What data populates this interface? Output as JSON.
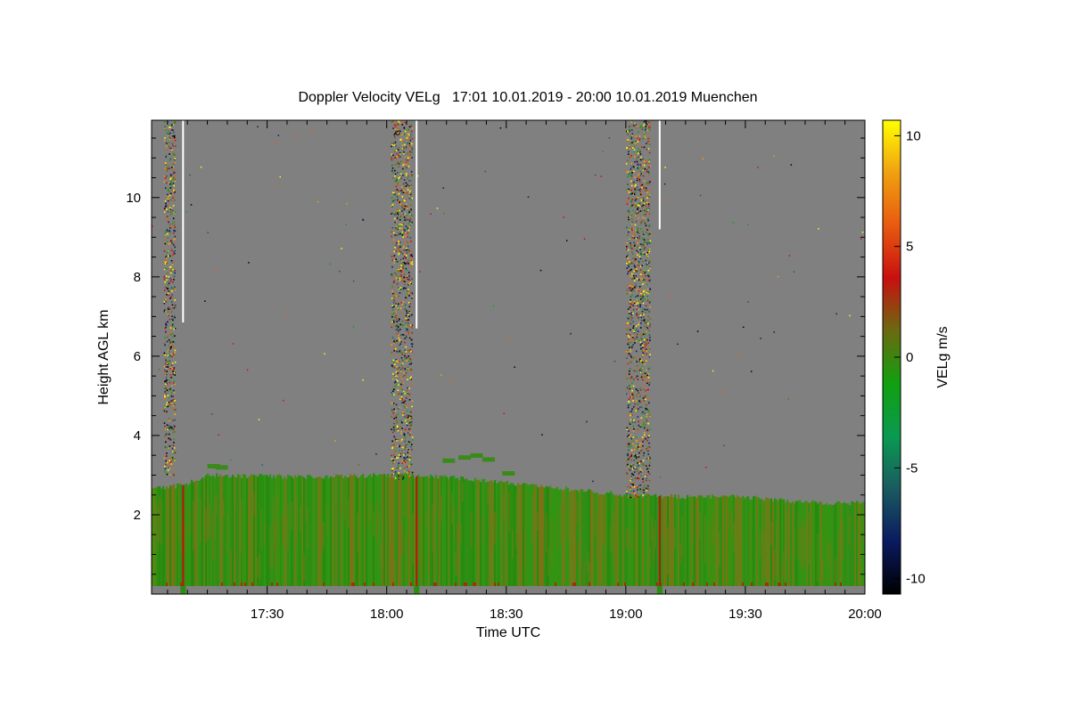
{
  "chart_data": {
    "type": "heatmap",
    "title": "Doppler Velocity VELg   17:01 10.01.2019 - 20:00 10.01.2019 Muenchen",
    "xlabel": "Time UTC",
    "ylabel": "Height AGL km",
    "colorbar_label": "VELg m/s",
    "x_range_minutes": [
      1021,
      1200
    ],
    "ylim": [
      0,
      11.95
    ],
    "x_ticks": [
      {
        "label": "17:30",
        "minutes": 1050
      },
      {
        "label": "18:00",
        "minutes": 1080
      },
      {
        "label": "18:30",
        "minutes": 1110
      },
      {
        "label": "19:00",
        "minutes": 1140
      },
      {
        "label": "19:30",
        "minutes": 1170
      },
      {
        "label": "20:00",
        "minutes": 1200
      }
    ],
    "y_ticks": [
      {
        "label": "2",
        "value": 2
      },
      {
        "label": "4",
        "value": 4
      },
      {
        "label": "6",
        "value": 6
      },
      {
        "label": "8",
        "value": 8
      },
      {
        "label": "10",
        "value": 10
      }
    ],
    "colorbar_range": [
      -10.7,
      10.7
    ],
    "colorbar_ticks": [
      {
        "label": "10",
        "value": 10
      },
      {
        "label": "5",
        "value": 5
      },
      {
        "label": "0",
        "value": 0
      },
      {
        "label": "-5",
        "value": -5
      },
      {
        "label": "-10",
        "value": -10
      }
    ],
    "colors": {
      "background_no_signal": "#808080",
      "boundary_layer_main": "#2a8f10",
      "boundary_layer_alt": "#6e7a18",
      "colormap": [
        "#000000",
        "#0a1a60",
        "#1a5a60",
        "#0a9a50",
        "#10a010",
        "#6a6a10",
        "#c81010",
        "#e85a10",
        "#f0a010",
        "#ffff00"
      ]
    },
    "boundary_layer_top_km": [
      {
        "minutes": 1021,
        "km": 2.65
      },
      {
        "minutes": 1029,
        "km": 2.75
      },
      {
        "minutes": 1035,
        "km": 3.0
      },
      {
        "minutes": 1060,
        "km": 2.95
      },
      {
        "minutes": 1080,
        "km": 3.0
      },
      {
        "minutes": 1095,
        "km": 2.95
      },
      {
        "minutes": 1110,
        "km": 2.8
      },
      {
        "minutes": 1125,
        "km": 2.65
      },
      {
        "minutes": 1140,
        "km": 2.5
      },
      {
        "minutes": 1155,
        "km": 2.45
      },
      {
        "minutes": 1170,
        "km": 2.45
      },
      {
        "minutes": 1185,
        "km": 2.3
      },
      {
        "minutes": 1200,
        "km": 2.3
      }
    ],
    "noise_scan_bands": [
      {
        "start_minutes": 1024,
        "end_minutes": 1026.8,
        "km_from": 3.0,
        "km_to": 11.95
      },
      {
        "start_minutes": 1081,
        "end_minutes": 1086.3,
        "km_from": 2.9,
        "km_to": 11.95
      },
      {
        "start_minutes": 1140,
        "end_minutes": 1146,
        "km_from": 2.45,
        "km_to": 11.95
      }
    ],
    "white_streaks": [
      {
        "minutes": 1028.9,
        "km_from": 6.85,
        "km_to": 11.95
      },
      {
        "minutes": 1087.5,
        "km_from": 6.7,
        "km_to": 11.95
      },
      {
        "minutes": 1148.5,
        "km_from": 9.2,
        "km_to": 11.95
      }
    ],
    "red_spikes_minutes": [
      1028.9,
      1087.5,
      1148.5
    ]
  }
}
